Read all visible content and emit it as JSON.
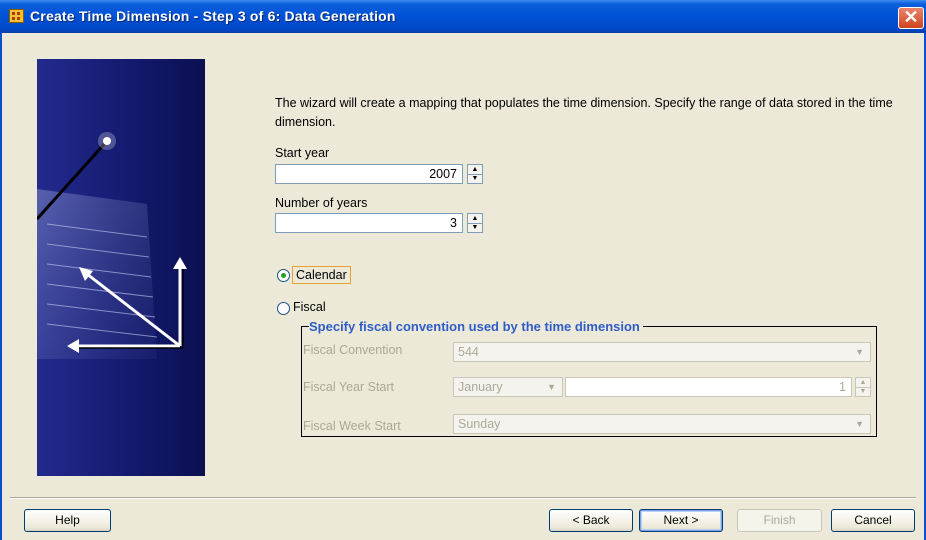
{
  "window": {
    "title": "Create Time Dimension - Step 3 of 6: Data Generation",
    "close_symbol": "✕"
  },
  "intro_text": "The wizard will create a mapping that populates the time dimension. Specify the range of data stored in the time dimension.",
  "start_year": {
    "label": "Start year",
    "value": "2007"
  },
  "number_of_years": {
    "label": "Number of years",
    "value": "3"
  },
  "calendar_option": {
    "label": "Calendar",
    "selected": true
  },
  "fiscal_option": {
    "label": "Fiscal",
    "selected": false
  },
  "fiscal_group": {
    "title": "Specify fiscal convention used by the time dimension",
    "convention": {
      "label": "Fiscal Convention",
      "value": "544"
    },
    "year_start": {
      "label": "Fiscal Year Start",
      "month": "January",
      "day": "1"
    },
    "week_start": {
      "label": "Fiscal Week Start",
      "value": "Sunday"
    }
  },
  "buttons": {
    "help": "Help",
    "back": "< Back",
    "next": "Next >",
    "finish": "Finish",
    "cancel": "Cancel"
  },
  "icons": {
    "title": "time-dimension-icon",
    "spinner_up": "▲",
    "spinner_down": "▼",
    "dropdown": "▼"
  },
  "colors": {
    "titlebar": "#0051d6",
    "dialog_bg": "#ece9d8",
    "group_title": "#2f5dc7",
    "banner": "#141a6e",
    "radio_dot": "#21a121"
  }
}
